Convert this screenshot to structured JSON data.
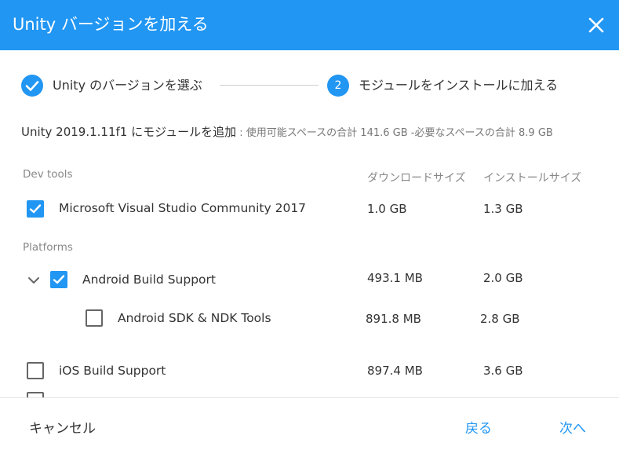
{
  "header": {
    "title": "Unity バージョンを加える",
    "close_icon": "close-icon"
  },
  "steps": [
    {
      "label": "Unity のバージョンを選ぶ",
      "state": "done",
      "icon": "check-icon"
    },
    {
      "number": "2",
      "label": "モジュールをインストールに加える",
      "state": "active"
    }
  ],
  "summary": {
    "main": "Unity 2019.1.11f1 にモジュールを追加",
    "sub": " : 使用可能スペースの合計 141.6 GB -必要なスペースの合計 8.9 GB"
  },
  "columns": {
    "download": "ダウンロードサイズ",
    "install": "インストールサイズ"
  },
  "sections": {
    "dev_tools": "Dev tools",
    "platforms": "Platforms"
  },
  "modules": [
    {
      "name": "Microsoft Visual Studio Community 2017",
      "download": "1.0 GB",
      "install": "1.3 GB",
      "checked": true
    },
    {
      "name": "Android Build Support",
      "download": "493.1 MB",
      "install": "2.0 GB",
      "checked": true,
      "expanded": true
    },
    {
      "name": "Android SDK & NDK Tools",
      "download": "891.8 MB",
      "install": "2.8 GB",
      "checked": false
    },
    {
      "name": "iOS Build Support",
      "download": "897.4 MB",
      "install": "3.6 GB",
      "checked": false
    }
  ],
  "footer": {
    "cancel": "キャンセル",
    "back": "戻る",
    "next": "次へ"
  },
  "colors": {
    "accent": "#2196f3",
    "text": "#333333",
    "muted": "#888888"
  }
}
